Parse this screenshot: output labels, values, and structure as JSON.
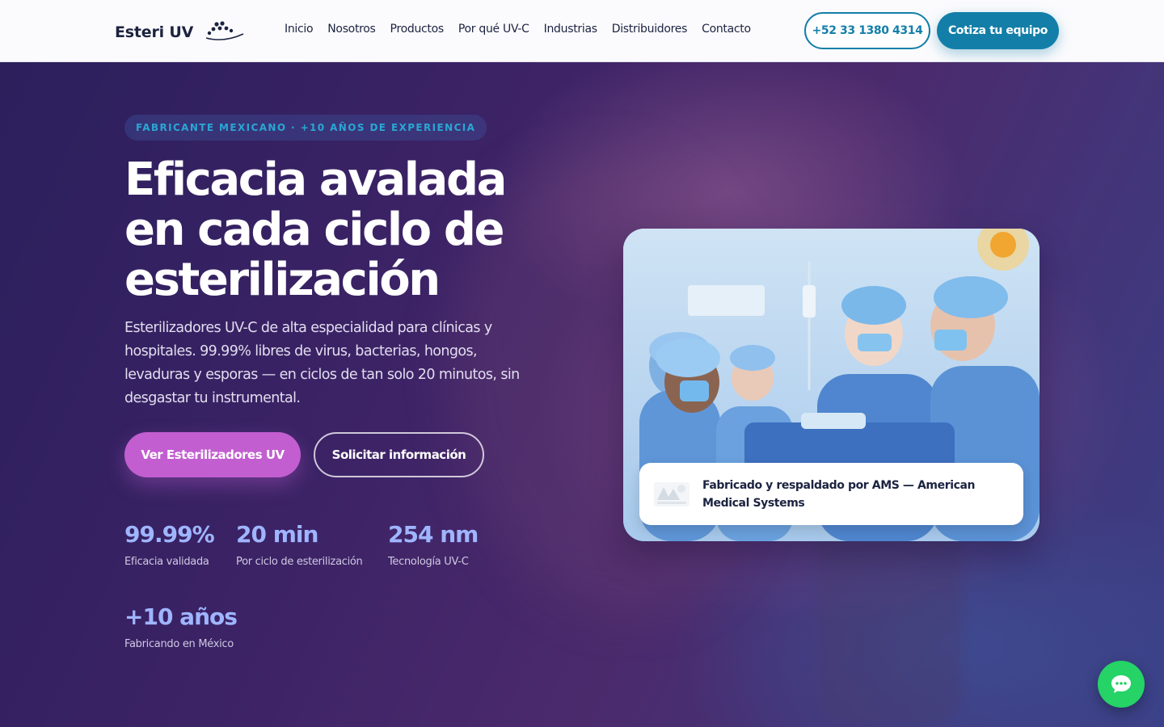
{
  "header": {
    "logo_text": "Esteri UV",
    "nav": [
      "Inicio",
      "Nosotros",
      "Productos",
      "Por qué UV-C",
      "Industrias",
      "Distribuidores",
      "Contacto"
    ],
    "phone_button": "+52 33 1380 4314",
    "quote_button": "Cotiza tu equipo"
  },
  "hero": {
    "badge": "FABRICANTE MEXICANO · +10 AÑOS DE EXPERIENCIA",
    "title": "Eficacia avalada en cada ciclo de esterilización",
    "description": "Esterilizadores UV-C de alta especialidad para clínicas y hospitales. 99.99% libres de virus, bacterias, hongos, levaduras y esporas — en ciclos de tan solo 20 minutos, sin desgastar tu instrumental.",
    "primary_button": "Ver Esterilizadores UV",
    "secondary_button": "Solicitar información",
    "stats": [
      {
        "value": "99.99%",
        "label": "Eficacia validada"
      },
      {
        "value": "20 min",
        "label": "Por ciclo de esterilización"
      },
      {
        "value": "254 nm",
        "label": "Tecnología UV-C"
      },
      {
        "value": "+10 años",
        "label": "Fabricando en México"
      }
    ],
    "image_caption": "Fabricado y respaldado por AMS — American Medical Systems"
  },
  "colors": {
    "brand_teal": "#137fa8",
    "accent_purple": "#c25ed0",
    "stat_blue": "#9fb5ff",
    "chat_green": "#25d366"
  },
  "icons": {
    "logo_mark": "dots-wave-logo",
    "caption_logo": "ams-logo",
    "chat": "chat-bubble-icon"
  }
}
